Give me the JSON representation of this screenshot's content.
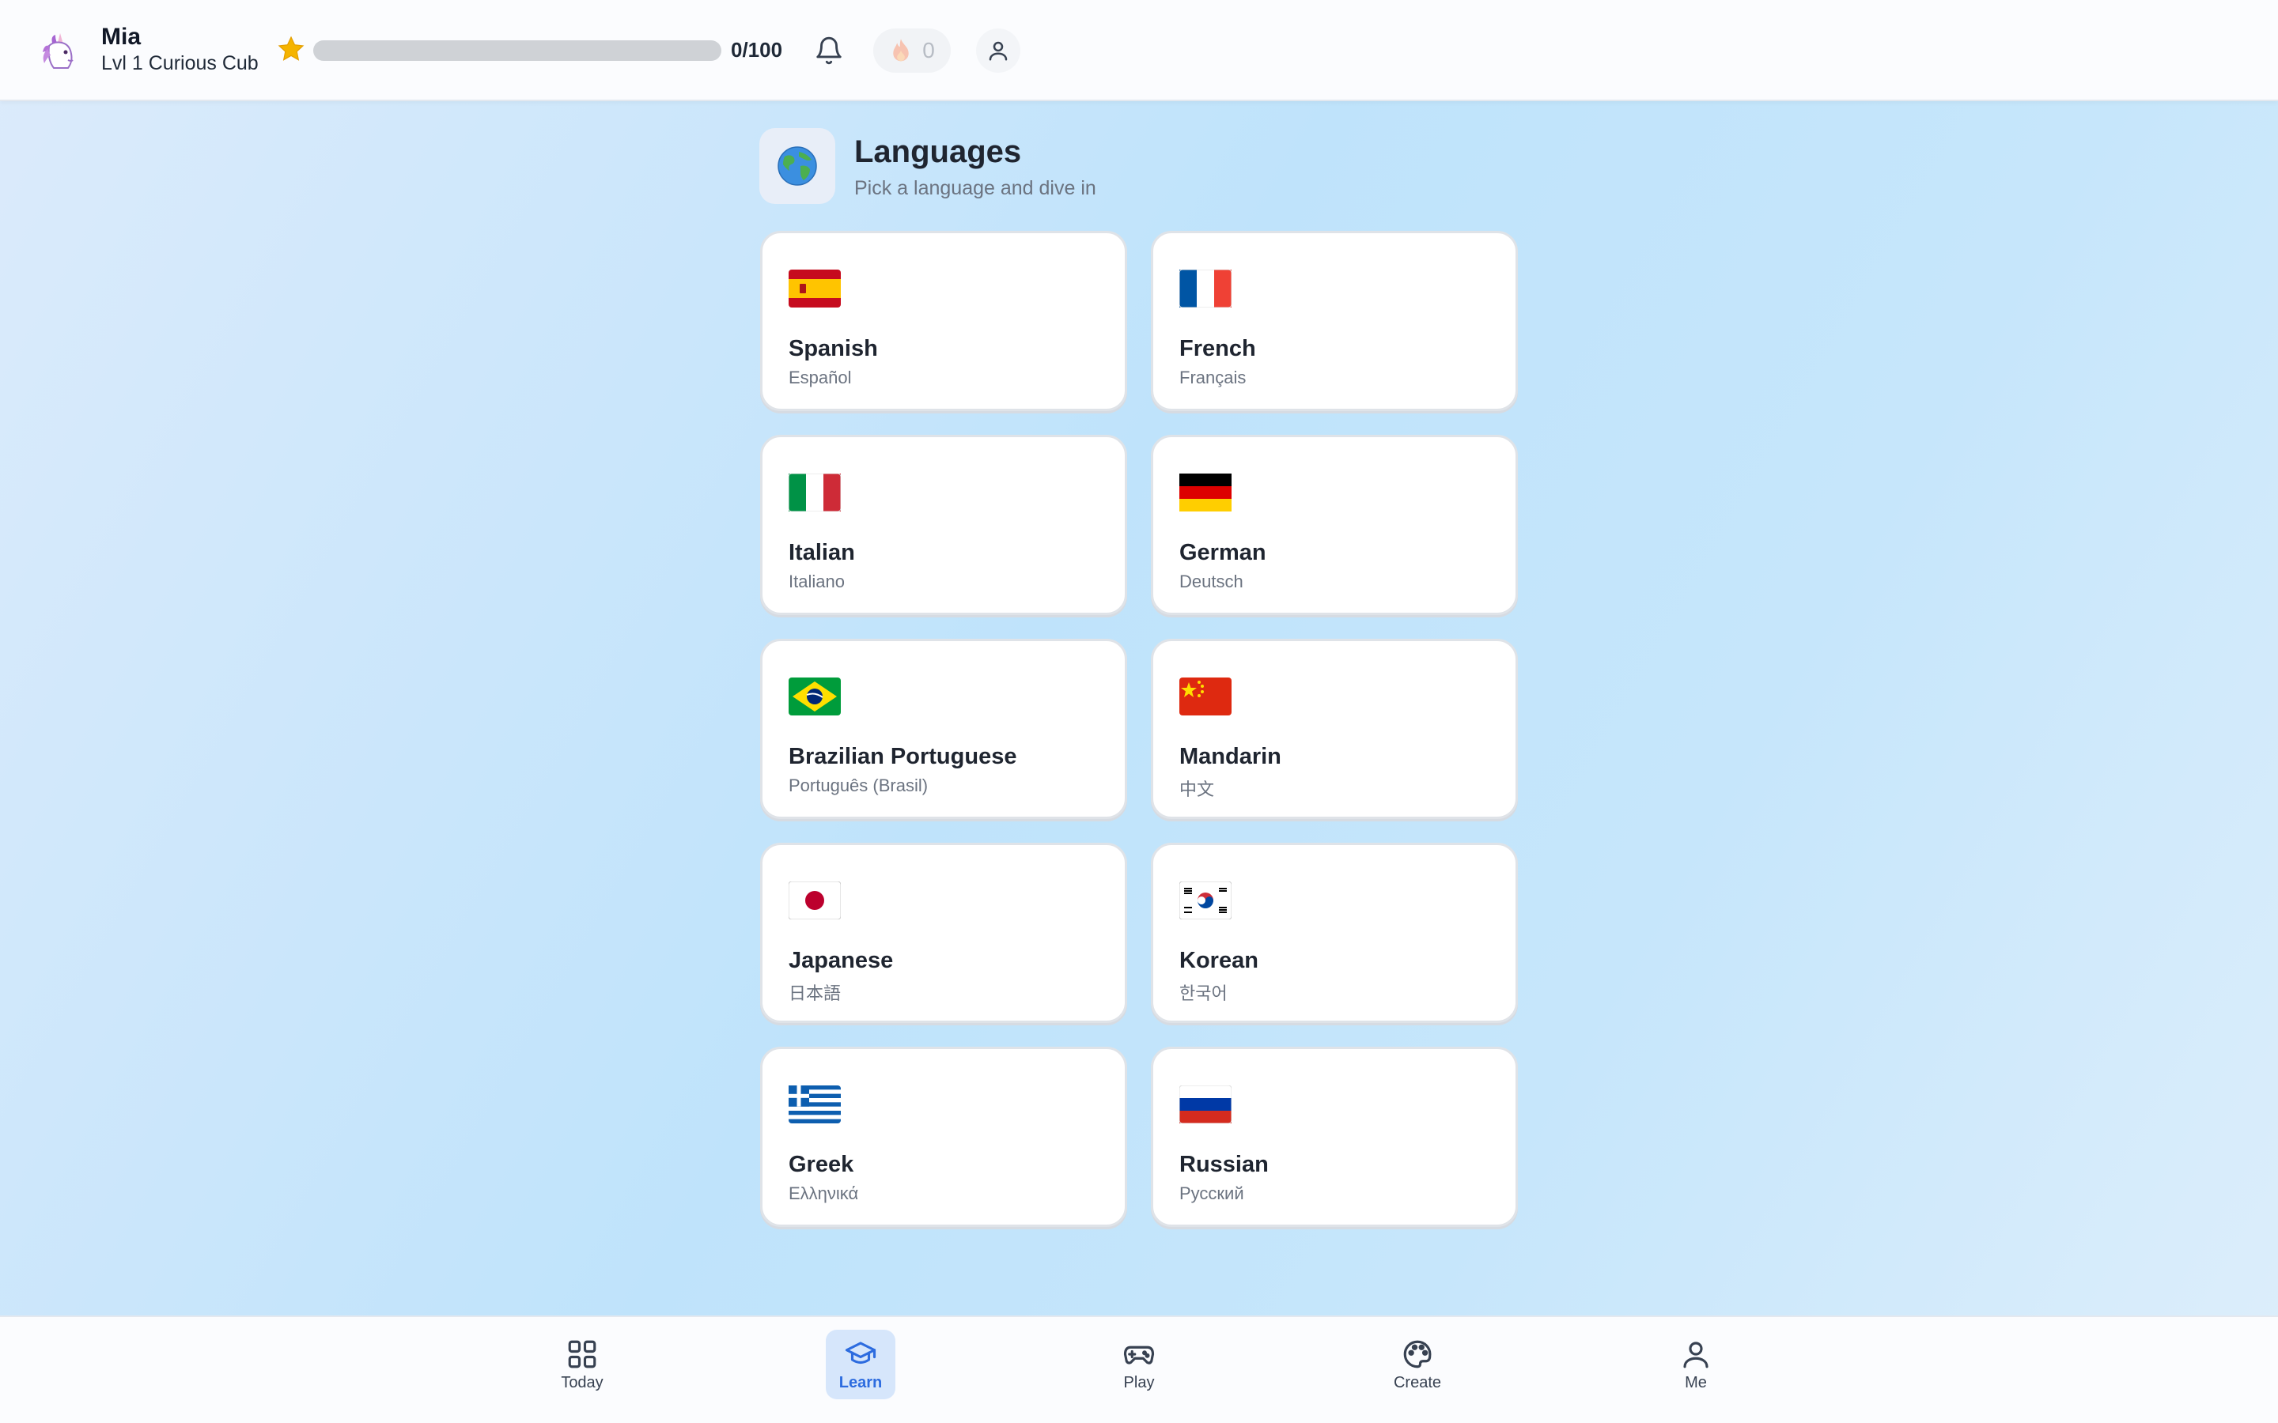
{
  "header": {
    "user_name": "Mia",
    "user_level": "Lvl 1 Curious Cub",
    "xp_text": "0/100",
    "xp_progress": 0,
    "streak_count": "0",
    "avatar_icon": "unicorn-icon"
  },
  "section": {
    "icon": "globe-icon",
    "title": "Languages",
    "subtitle": "Pick a language and dive in"
  },
  "languages": [
    {
      "name": "Spanish",
      "native": "Español",
      "flag": "spain-flag-icon"
    },
    {
      "name": "French",
      "native": "Français",
      "flag": "france-flag-icon"
    },
    {
      "name": "Italian",
      "native": "Italiano",
      "flag": "italy-flag-icon"
    },
    {
      "name": "German",
      "native": "Deutsch",
      "flag": "germany-flag-icon"
    },
    {
      "name": "Brazilian Portuguese",
      "native": "Português (Brasil)",
      "flag": "brazil-flag-icon"
    },
    {
      "name": "Mandarin",
      "native": "中文",
      "flag": "china-flag-icon"
    },
    {
      "name": "Japanese",
      "native": "日本語",
      "flag": "japan-flag-icon"
    },
    {
      "name": "Korean",
      "native": "한국어",
      "flag": "korea-flag-icon"
    },
    {
      "name": "Greek",
      "native": "Ελληνικά",
      "flag": "greece-flag-icon"
    },
    {
      "name": "Russian",
      "native": "Русский",
      "flag": "russia-flag-icon"
    }
  ],
  "nav": {
    "active": "learn",
    "items": [
      {
        "label": "Today",
        "icon": "grid-icon"
      },
      {
        "label": "Learn",
        "icon": "graduation-cap-icon"
      },
      {
        "label": "Play",
        "icon": "gamepad-icon"
      },
      {
        "label": "Create",
        "icon": "palette-icon"
      },
      {
        "label": "Me",
        "icon": "person-icon"
      }
    ]
  },
  "colors": {
    "accent": "#2d6cdf",
    "star": "#f5b400",
    "card_border": "#dfe3e8"
  }
}
